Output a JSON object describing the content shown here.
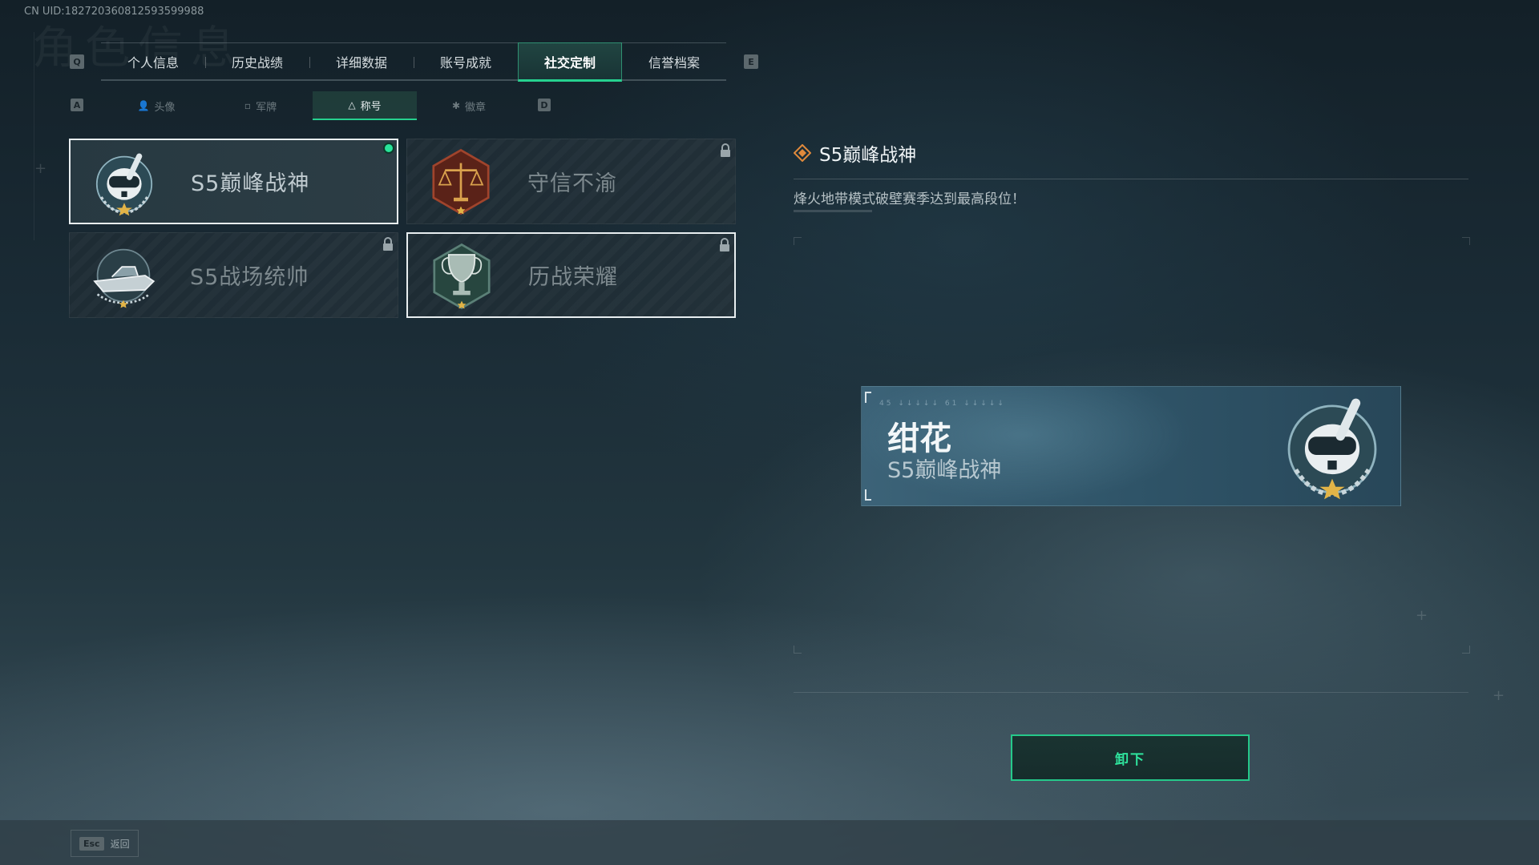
{
  "uid": "CN UID:182720360812593599988",
  "bg_title": "角色信息",
  "main_tabs": {
    "prev_key": "Q",
    "next_key": "E",
    "items": [
      {
        "label": "个人信息"
      },
      {
        "label": "历史战绩"
      },
      {
        "label": "详细数据"
      },
      {
        "label": "账号成就"
      },
      {
        "label": "社交定制",
        "active": true
      },
      {
        "label": "信誉档案"
      }
    ]
  },
  "sub_tabs": {
    "prev_key": "A",
    "next_key": "D",
    "items": [
      {
        "label": "头像",
        "icon": "person-icon"
      },
      {
        "label": "军牌",
        "icon": "dogtag-icon"
      },
      {
        "label": "称号",
        "icon": "title-icon",
        "active": true
      },
      {
        "label": "徽章",
        "icon": "badge-icon"
      }
    ]
  },
  "cards": [
    {
      "label": "S5巅峰战神",
      "emblem": "diver-skull-emblem",
      "equipped": true,
      "locked": false,
      "selected": true
    },
    {
      "label": "守信不渝",
      "emblem": "scales-emblem",
      "equipped": false,
      "locked": true,
      "selected": false
    },
    {
      "label": "S5战场统帅",
      "emblem": "speedboat-emblem",
      "equipped": false,
      "locked": true,
      "selected": false
    },
    {
      "label": "历战荣耀",
      "emblem": "trophy-emblem",
      "equipped": false,
      "locked": true,
      "selected": false,
      "hover": true
    }
  ],
  "detail": {
    "title": "S5巅峰战神",
    "title_icon": "diamond-icon",
    "description": "烽火地带模式破壁赛季达到最高段位！"
  },
  "preview": {
    "code": "45  ↓↓↓↓↓   61  ↓↓↓↓↓",
    "player_name": "绀花",
    "title": "S5巅峰战神"
  },
  "action_button": "卸下",
  "footer": {
    "key": "Esc",
    "label": "返回"
  },
  "colors": {
    "accent_green": "#26d18f",
    "equipped_dot": "#29e39a",
    "diamond": "#e08a3c",
    "nameplate": "#2f5468"
  }
}
